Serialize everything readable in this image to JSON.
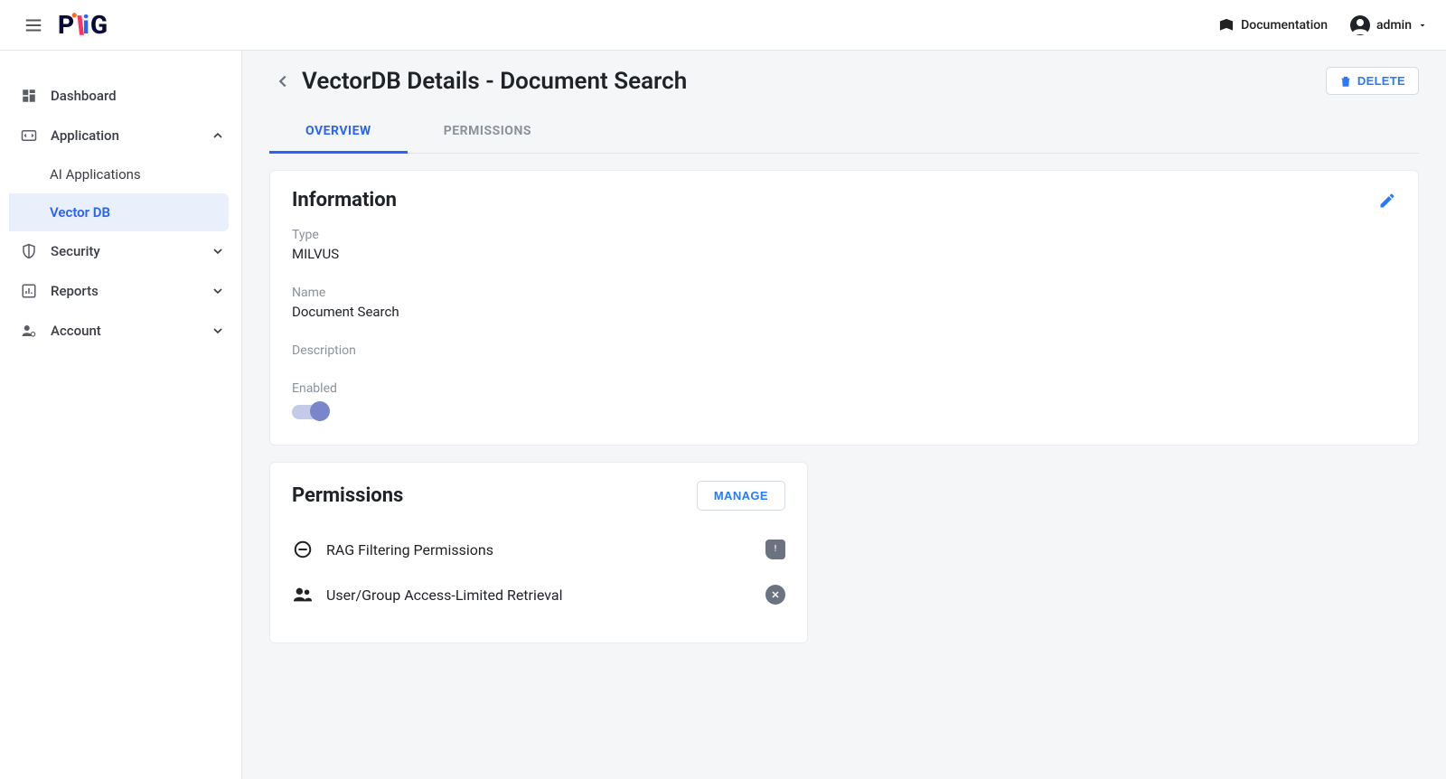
{
  "header": {
    "documentation_label": "Documentation",
    "username": "admin"
  },
  "sidebar": {
    "dashboard_label": "Dashboard",
    "application_label": "Application",
    "ai_applications_label": "AI Applications",
    "vector_db_label": "Vector DB",
    "security_label": "Security",
    "reports_label": "Reports",
    "account_label": "Account"
  },
  "page": {
    "title": "VectorDB Details - Document Search",
    "delete_label": "DELETE"
  },
  "tabs": {
    "overview": "OVERVIEW",
    "permissions": "PERMISSIONS"
  },
  "information": {
    "card_title": "Information",
    "type_label": "Type",
    "type_value": "MILVUS",
    "name_label": "Name",
    "name_value": "Document Search",
    "description_label": "Description",
    "description_value": "",
    "enabled_label": "Enabled",
    "enabled_value": true
  },
  "permissions_card": {
    "title": "Permissions",
    "manage_label": "MANAGE",
    "rows": [
      {
        "label": "RAG Filtering Permissions",
        "status": "alert"
      },
      {
        "label": "User/Group Access-Limited Retrieval",
        "status": "off"
      }
    ]
  }
}
